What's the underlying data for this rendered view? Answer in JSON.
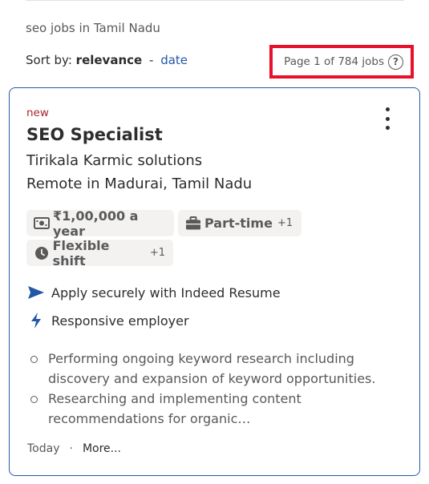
{
  "search": {
    "context": "seo jobs in Tamil Nadu"
  },
  "sort": {
    "label": "Sort by:",
    "relevance": "relevance",
    "separator": "-",
    "date": "date"
  },
  "pagination": {
    "text": "Page 1 of 784 jobs",
    "help_symbol": "?"
  },
  "job": {
    "badge": "new",
    "title": "SEO Specialist",
    "company": "Tirikala Karmic solutions",
    "location": "Remote in Madurai, Tamil Nadu",
    "tags": {
      "salary": "₹1,00,000 a year",
      "job_type": "Part-time",
      "job_type_extra": "+1",
      "shift": "Flexible shift",
      "shift_extra": "+1"
    },
    "features": {
      "apply": "Apply securely with Indeed Resume",
      "responsive": "Responsive employer"
    },
    "snippet": [
      "Performing ongoing keyword research including discovery and expansion of keyword opportunities.",
      "Researching and implementing content recommendations for organic…"
    ],
    "footer": {
      "posted": "Today",
      "separator": "·",
      "more": "More..."
    }
  },
  "colors": {
    "accent": "#2557a7",
    "highlight_box": "#e8102a",
    "new_badge": "#a9252b"
  },
  "icons": {
    "salary": "money-icon",
    "job_type": "briefcase-icon",
    "shift": "clock-icon",
    "apply": "send-arrow-icon",
    "responsive": "lightning-icon",
    "menu": "more-vertical-icon",
    "help": "help-circle-icon"
  }
}
